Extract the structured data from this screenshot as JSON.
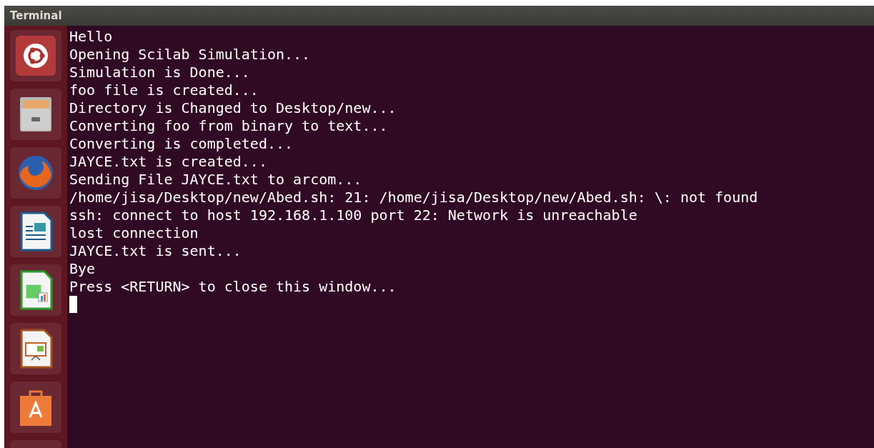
{
  "window": {
    "title": "Terminal"
  },
  "terminal": {
    "lines": [
      "Hello",
      "Opening Scilab Simulation...",
      "Simulation is Done...",
      "foo file is created...",
      "Directory is Changed to Desktop/new...",
      "Converting foo from binary to text...",
      "Converting is completed...",
      "JAYCE.txt is created...",
      "Sending File JAYCE.txt to arcom...",
      "/home/jisa/Desktop/new/Abed.sh: 21: /home/jisa/Desktop/new/Abed.sh: \\: not found",
      "ssh: connect to host 192.168.1.100 port 22: Network is unreachable",
      "lost connection",
      "JAYCE.txt is sent...",
      "Bye",
      "Press <RETURN> to close this window..."
    ]
  }
}
